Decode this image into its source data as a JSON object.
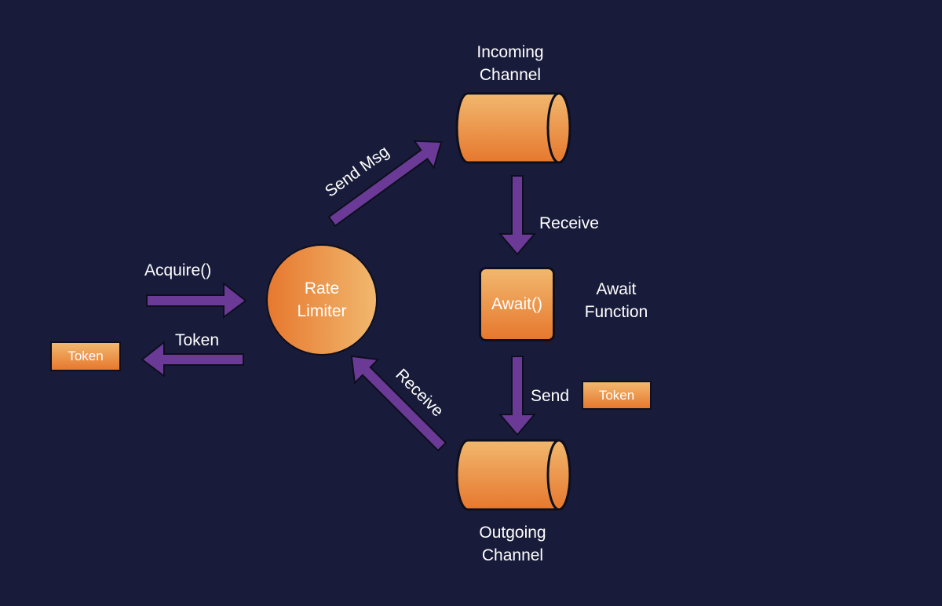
{
  "colors": {
    "background": "#181c3a",
    "arrow": "#6a3a96",
    "node_light": "#f1b86e",
    "node_dark": "#e6782e",
    "outline": "#0d0f1e",
    "text": "#ffffff"
  },
  "nodes": {
    "incoming_channel": {
      "label_line1": "Incoming",
      "label_line2": "Channel"
    },
    "outgoing_channel": {
      "label_line1": "Outgoing",
      "label_line2": "Channel"
    },
    "rate_limiter": {
      "label_line1": "Rate",
      "label_line2": "Limiter"
    },
    "await_box": {
      "label": "Await()"
    },
    "await_caption": {
      "line1": "Await",
      "line2": "Function"
    },
    "token_left": {
      "label": "Token"
    },
    "token_right": {
      "label": "Token"
    }
  },
  "edges": {
    "acquire": {
      "label": "Acquire()"
    },
    "token_return": {
      "label": "Token"
    },
    "send_msg": {
      "label": "Send Msg"
    },
    "receive_incoming": {
      "label": "Receive"
    },
    "send_outgoing": {
      "label": "Send"
    },
    "receive_outgoing": {
      "label": "Receive"
    }
  }
}
